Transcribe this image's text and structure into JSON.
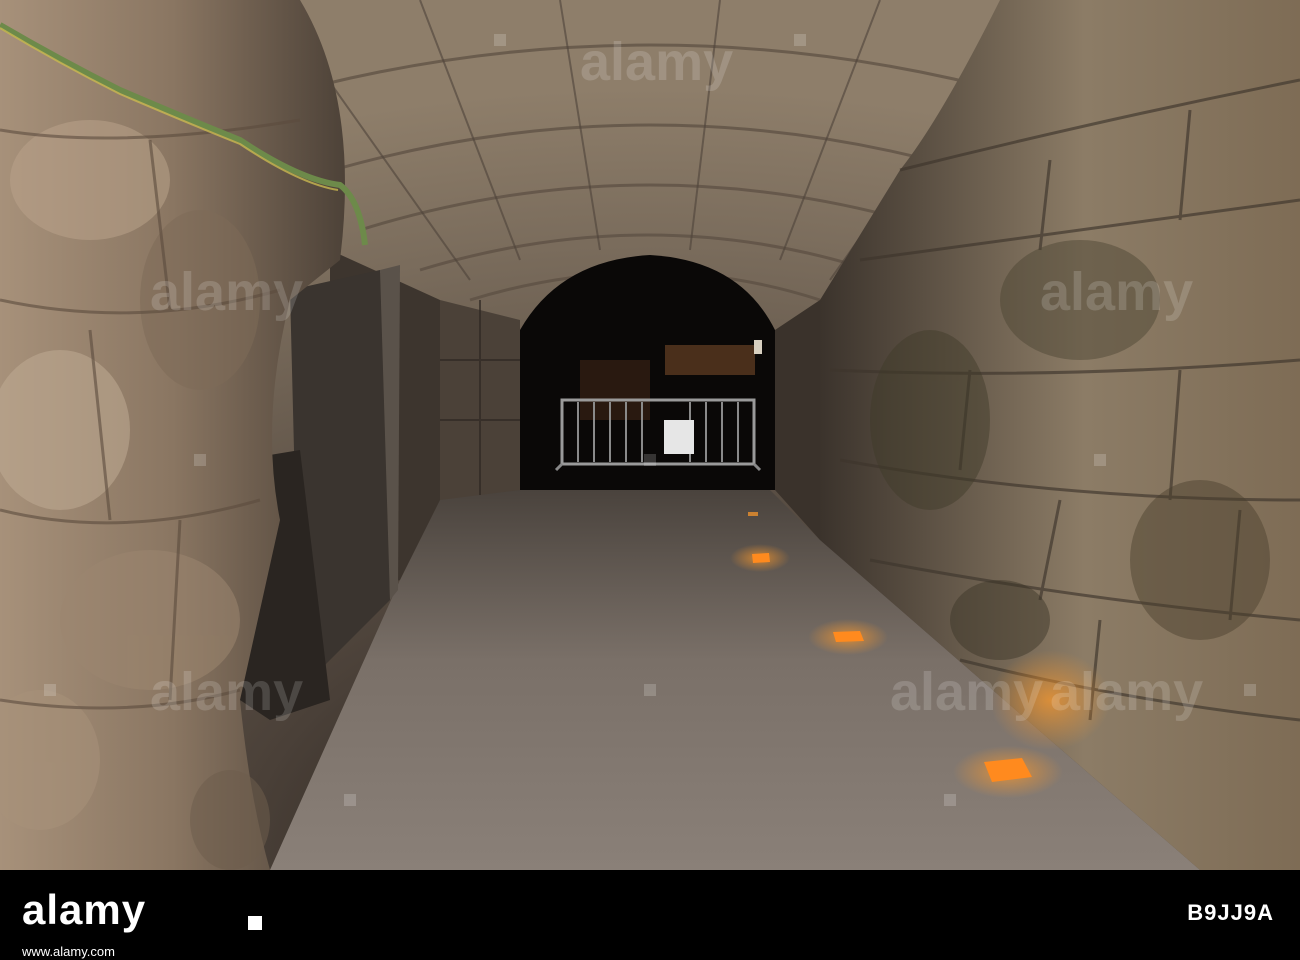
{
  "photo": {
    "colors": {
      "stone_light": "#a08c74",
      "stone_dark": "#3a322b",
      "floor": "#7b7167",
      "tunnel_end": "#0a0807",
      "cable": "#6d8a4a",
      "floor_light": "#ff8a1e"
    },
    "watermark": {
      "text": "alamy"
    }
  },
  "footer": {
    "logo": "alamy",
    "url": "www.alamy.com",
    "image_id": "B9JJ9A"
  }
}
